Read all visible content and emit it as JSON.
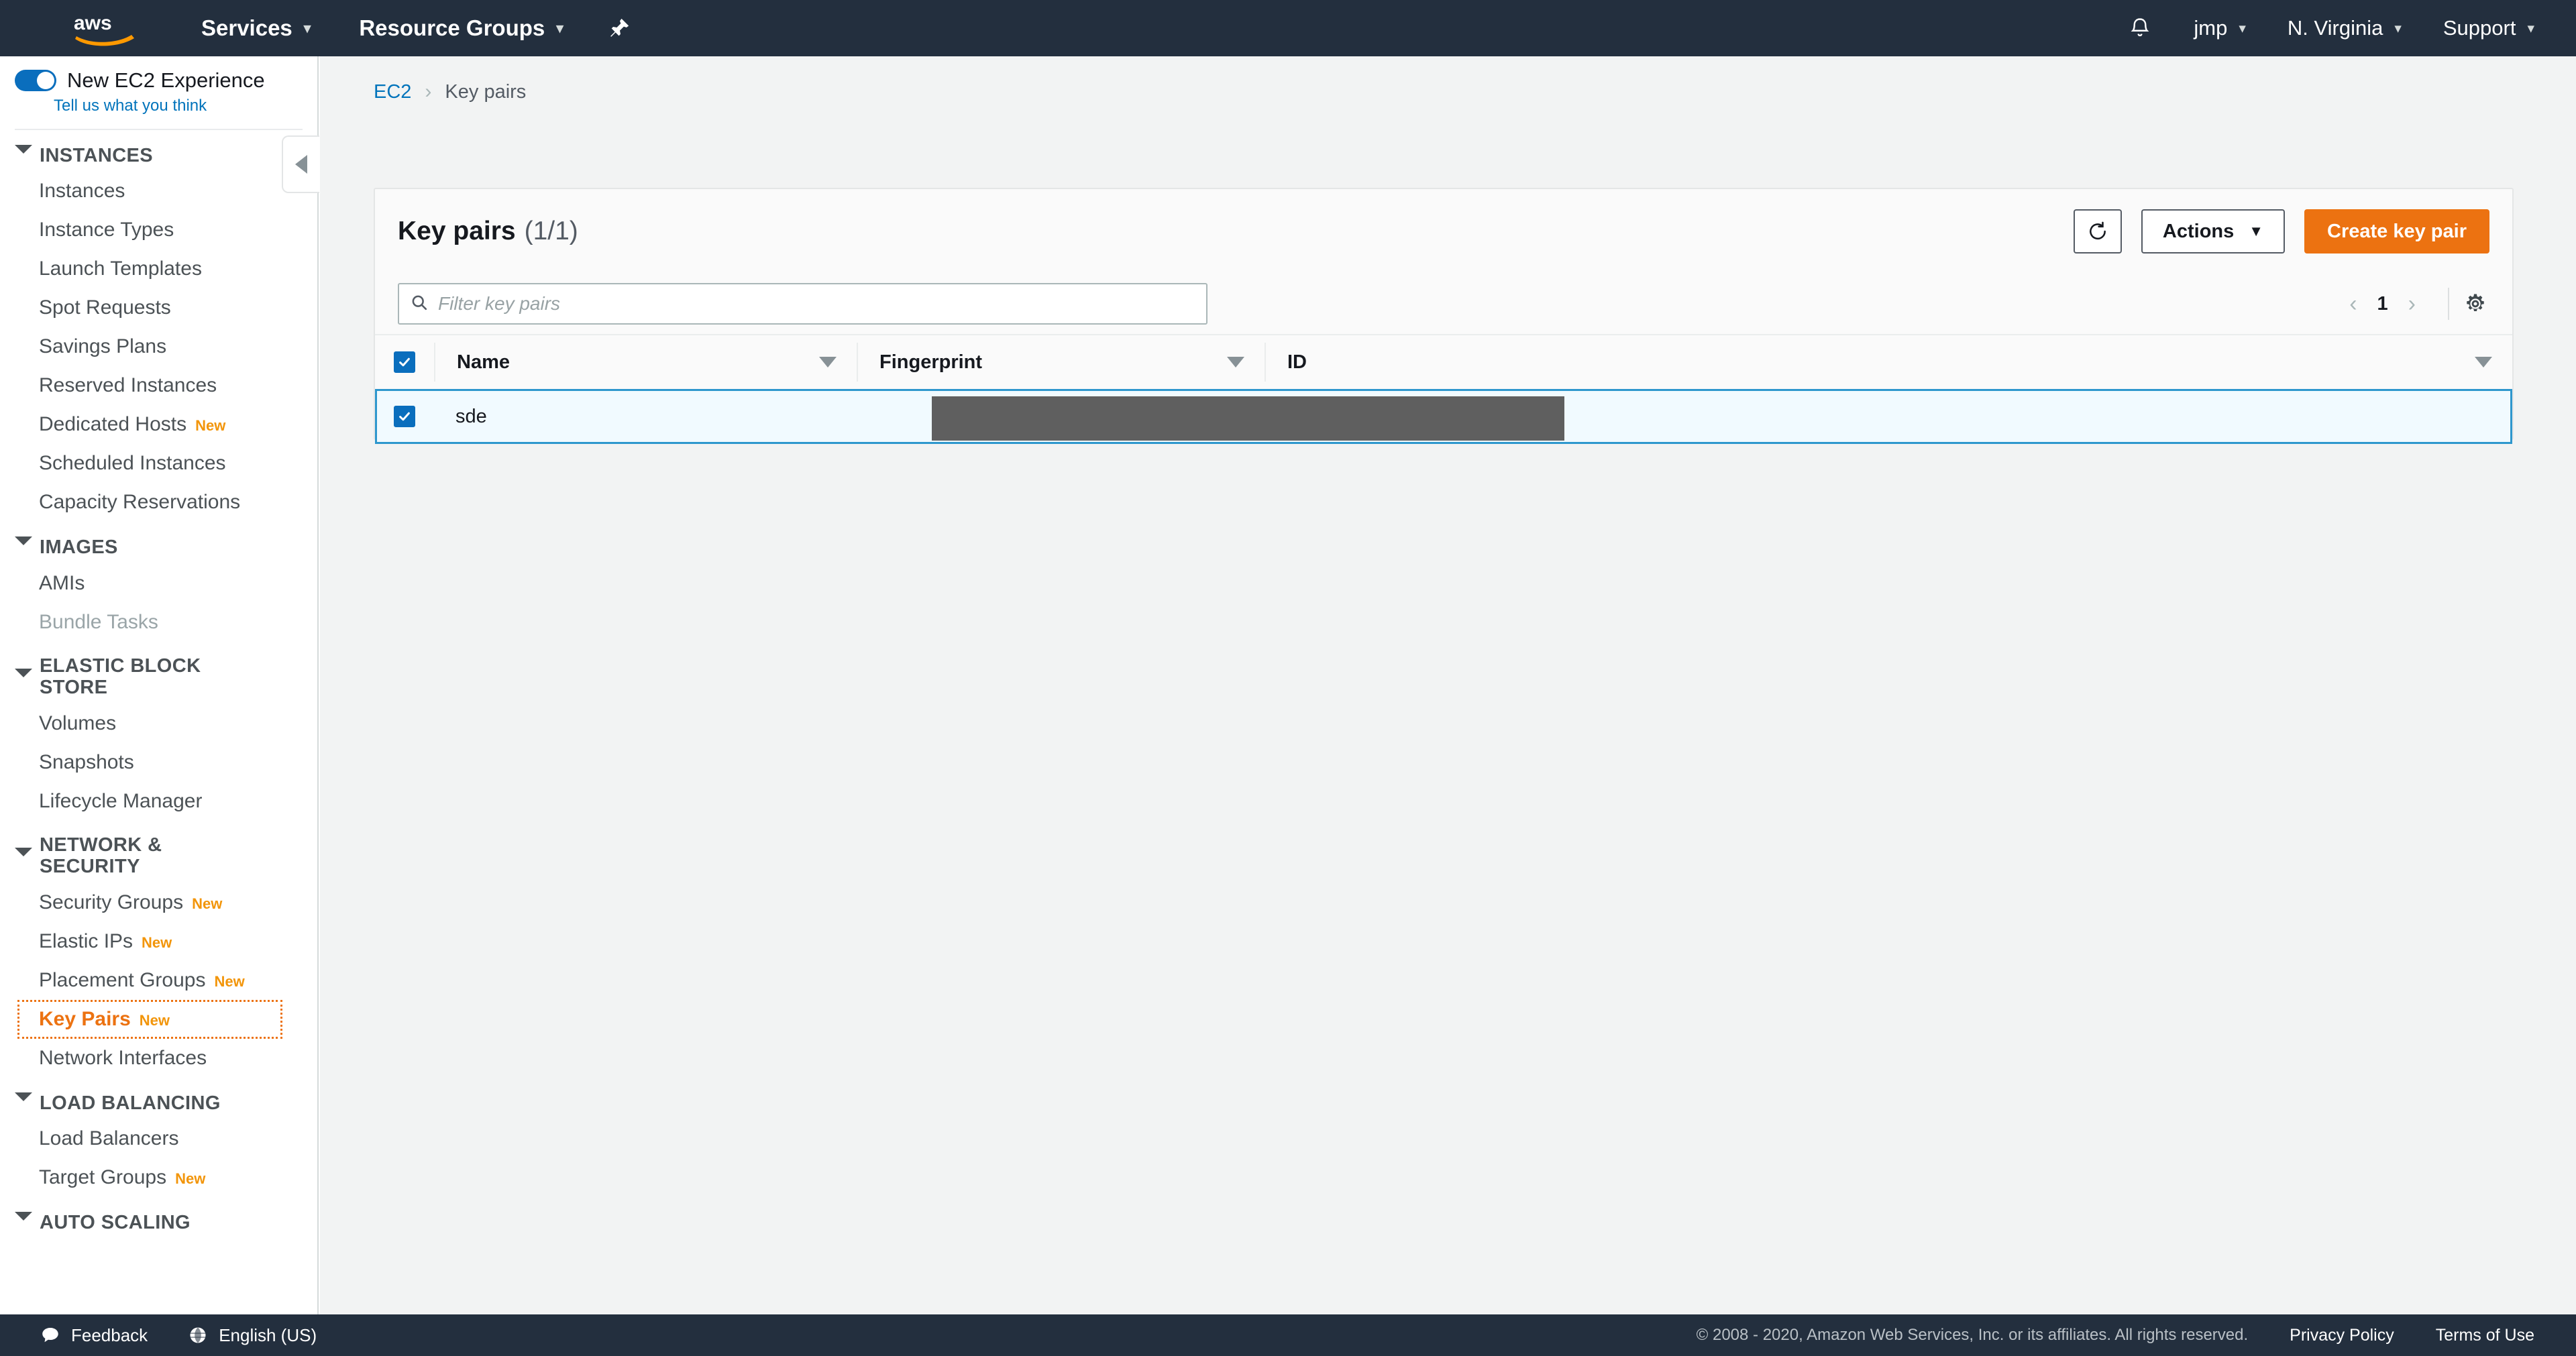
{
  "topnav": {
    "logo_alt": "aws",
    "items": [
      {
        "label": "Services",
        "caret": "▾"
      },
      {
        "label": "Resource Groups",
        "caret": "▾"
      }
    ],
    "pin_icon": "pushpin-icon",
    "bell_icon": "bell-icon",
    "right_items": [
      {
        "label": "jmp",
        "caret": "▾"
      },
      {
        "label": "N. Virginia",
        "caret": "▾"
      },
      {
        "label": "Support",
        "caret": "▾"
      }
    ]
  },
  "sidebar": {
    "new_experience_label": "New EC2 Experience",
    "tell_us_link": "Tell us what you think",
    "toggle_on": true,
    "sections": [
      {
        "title": "INSTANCES",
        "items": [
          {
            "label": "Instances"
          },
          {
            "label": "Instance Types"
          },
          {
            "label": "Launch Templates"
          },
          {
            "label": "Spot Requests"
          },
          {
            "label": "Savings Plans"
          },
          {
            "label": "Reserved Instances"
          },
          {
            "label": "Dedicated Hosts",
            "badge": "New"
          },
          {
            "label": "Scheduled Instances"
          },
          {
            "label": "Capacity Reservations"
          }
        ]
      },
      {
        "title": "IMAGES",
        "items": [
          {
            "label": "AMIs"
          },
          {
            "label": "Bundle Tasks",
            "disabled": true
          }
        ]
      },
      {
        "title": "ELASTIC BLOCK STORE",
        "items": [
          {
            "label": "Volumes"
          },
          {
            "label": "Snapshots"
          },
          {
            "label": "Lifecycle Manager"
          }
        ]
      },
      {
        "title": "NETWORK & SECURITY",
        "items": [
          {
            "label": "Security Groups",
            "badge": "New"
          },
          {
            "label": "Elastic IPs",
            "badge": "New"
          },
          {
            "label": "Placement Groups",
            "badge": "New"
          },
          {
            "label": "Key Pairs",
            "badge": "New",
            "active": true
          },
          {
            "label": "Network Interfaces"
          }
        ]
      },
      {
        "title": "LOAD BALANCING",
        "items": [
          {
            "label": "Load Balancers"
          },
          {
            "label": "Target Groups",
            "badge": "New"
          }
        ]
      },
      {
        "title": "AUTO SCALING",
        "items": []
      }
    ],
    "collapse_icon": "chevron-left-icon"
  },
  "breadcrumb": {
    "root": "EC2",
    "separator": "›",
    "current": "Key pairs"
  },
  "panel": {
    "title": "Key pairs",
    "count": "(1/1)",
    "refresh_icon": "refresh-icon",
    "actions_label": "Actions",
    "actions_caret": "▼",
    "create_label": "Create key pair",
    "highlight_color": "#e8441f",
    "primary_color": "#ec7211"
  },
  "filter": {
    "placeholder": "Filter key pairs",
    "value": "",
    "icon": "search-icon"
  },
  "pagination": {
    "prev": "‹",
    "page": "1",
    "next": "›",
    "settings_icon": "gear-icon"
  },
  "table": {
    "select_all_checked": true,
    "columns": [
      {
        "label": "Name",
        "sortable": true
      },
      {
        "label": "Fingerprint",
        "sortable": true
      },
      {
        "label": "ID",
        "sortable": true
      }
    ],
    "rows": [
      {
        "selected": true,
        "name": "sde",
        "fingerprint": "",
        "fingerprint_redacted": true,
        "id": ""
      }
    ]
  },
  "footer": {
    "feedback_label": "Feedback",
    "feedback_icon": "speech-bubble-icon",
    "language_label": "English (US)",
    "language_icon": "globe-icon",
    "copyright": "© 2008 - 2020, Amazon Web Services, Inc. or its affiliates. All rights reserved.",
    "privacy_label": "Privacy Policy",
    "terms_label": "Terms of Use"
  }
}
